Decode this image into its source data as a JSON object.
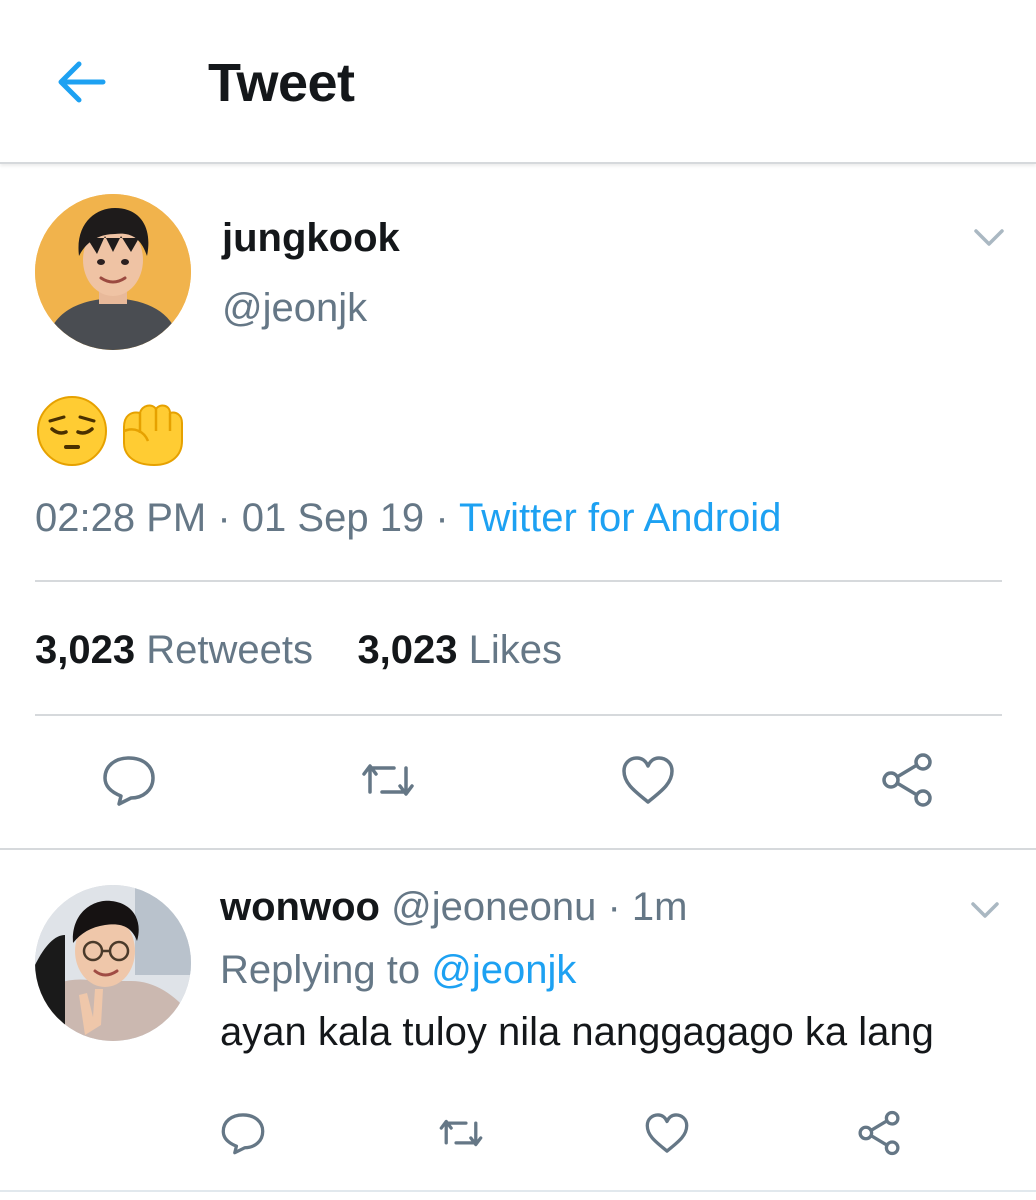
{
  "header": {
    "title": "Tweet",
    "back_icon": "arrow-left-icon",
    "accent": "#1da1f2"
  },
  "tweet": {
    "display_name": "jungkook",
    "handle": "@jeonjk",
    "content_emojis": "😔✊",
    "time": "02:28 PM",
    "date": "01 Sep 19",
    "separator": "·",
    "source": "Twitter for Android",
    "retweets_count": "3,023",
    "retweets_label": "Retweets",
    "likes_count": "3,023",
    "likes_label": "Likes",
    "actions": [
      "reply-icon",
      "retweet-icon",
      "like-icon",
      "share-icon"
    ]
  },
  "reply": {
    "display_name": "wonwoo",
    "handle": "@jeoneonu",
    "separator": "·",
    "age": "1m",
    "replying_prefix": "Replying to",
    "replying_to": "@jeonjk",
    "text": "ayan kala tuloy nila nanggagago ka lang",
    "actions": [
      "reply-icon",
      "retweet-icon",
      "like-icon",
      "share-icon"
    ]
  },
  "colors": {
    "text": "#14171a",
    "secondary": "#657786",
    "link": "#1da1f2",
    "divider": "#d6d9dc"
  }
}
